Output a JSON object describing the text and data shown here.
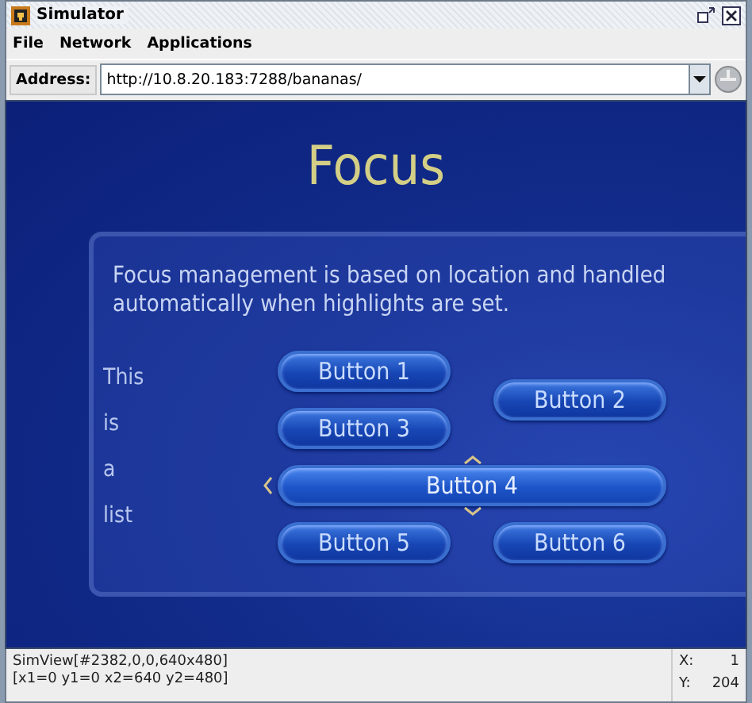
{
  "window": {
    "title": "Simulator"
  },
  "menu": [
    "File",
    "Network",
    "Applications"
  ],
  "address": {
    "label": "Address:",
    "value": "http://10.8.20.183:7288/bananas/"
  },
  "screen": {
    "title": "Focus",
    "description": "Focus management is based on location and handled automatically when highlights are set.",
    "list_words": [
      "This",
      "is",
      "a",
      "list"
    ],
    "buttons": [
      {
        "label": "Button 1",
        "focused": false
      },
      {
        "label": "Button 2",
        "focused": false
      },
      {
        "label": "Button 3",
        "focused": false
      },
      {
        "label": "Button 4",
        "focused": true
      },
      {
        "label": "Button 5",
        "focused": false
      },
      {
        "label": "Button 6",
        "focused": false
      }
    ]
  },
  "status_bar": {
    "lines": [
      "SimView[#2382,0,0,640x480]",
      "[x1=0 y1=0 x2=640 y2=480]"
    ],
    "x_label": "X:",
    "x_value": "1",
    "y_label": "Y:",
    "y_value": "204"
  }
}
